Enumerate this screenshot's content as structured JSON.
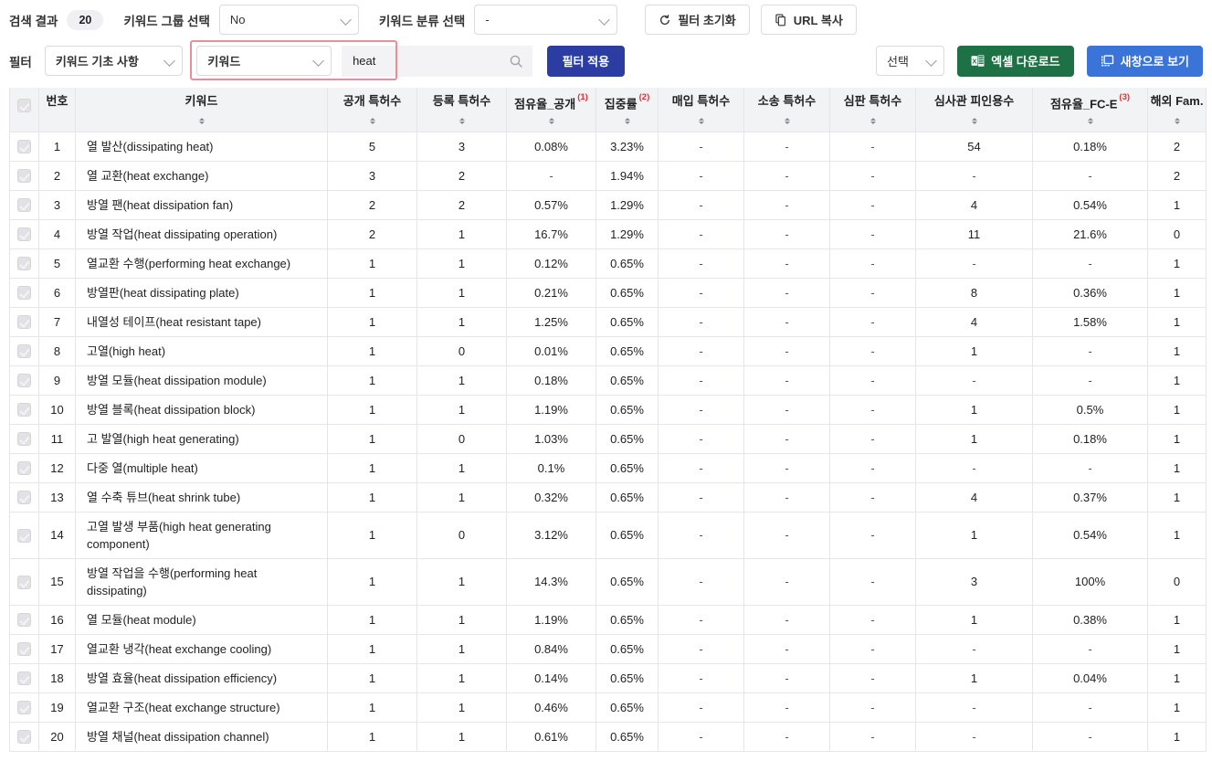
{
  "toolbar": {
    "result_label": "검색 결과",
    "result_count": "20",
    "group_label": "키워드 그룹 선택",
    "group_value": "No",
    "class_label": "키워드 분류 선택",
    "class_value": "-",
    "reset_button": "필터 초기화",
    "reset_icon": "refresh-icon",
    "copy_url_button": "URL 복사",
    "copy_url_icon": "copy-icon",
    "filter_label": "필터",
    "filter_field_value": "키워드 기초 사항",
    "filter_key_value": "키워드",
    "search_value": "heat",
    "search_placeholder": "",
    "search_icon": "search-icon",
    "apply_button": "필터 적용",
    "select_value": "선택",
    "excel_button": "엑셀 다운로드",
    "excel_icon": "excel-icon",
    "newwindow_button": "새창으로 보기",
    "newwindow_icon": "new-window-icon",
    "highlight_color": "#e98f99",
    "primary_color": "#2b3da3",
    "excel_color": "#1e7145",
    "newwindow_color": "#3b74d8",
    "superscript_color": "#e03131"
  },
  "table": {
    "columns": [
      {
        "key": "check",
        "label": "",
        "sup": "",
        "sortable": false
      },
      {
        "key": "no",
        "label": "번호",
        "sup": "",
        "sortable": false
      },
      {
        "key": "keyword",
        "label": "키워드",
        "sup": "",
        "sortable": true
      },
      {
        "key": "open_pat",
        "label": "공개 특허수",
        "sup": "",
        "sortable": true
      },
      {
        "key": "reg_pat",
        "label": "등록 특허수",
        "sup": "",
        "sortable": true
      },
      {
        "key": "share_open",
        "label": "점유율_공개",
        "sup": "(1)",
        "sortable": true
      },
      {
        "key": "conc",
        "label": "집중률",
        "sup": "(2)",
        "sortable": true
      },
      {
        "key": "buy_pat",
        "label": "매입 특허수",
        "sup": "",
        "sortable": true
      },
      {
        "key": "suit_pat",
        "label": "소송 특허수",
        "sup": "",
        "sortable": true
      },
      {
        "key": "trial_pat",
        "label": "심판 특허수",
        "sup": "",
        "sortable": true
      },
      {
        "key": "cited",
        "label": "심사관 피인용수",
        "sup": "",
        "sortable": true
      },
      {
        "key": "share_fce",
        "label": "점유율_FC-E",
        "sup": "(3)",
        "sortable": true
      },
      {
        "key": "overseas",
        "label": "해외 Fam.",
        "sup": "",
        "sortable": true
      }
    ],
    "rows": [
      {
        "no": "1",
        "keyword": "열 발산(dissipating heat)",
        "open_pat": "5",
        "reg_pat": "3",
        "share_open": "0.08%",
        "conc": "3.23%",
        "buy_pat": "-",
        "suit_pat": "-",
        "trial_pat": "-",
        "cited": "54",
        "share_fce": "0.18%",
        "overseas": "2",
        "checked": true
      },
      {
        "no": "2",
        "keyword": "열 교환(heat exchange)",
        "open_pat": "3",
        "reg_pat": "2",
        "share_open": "-",
        "conc": "1.94%",
        "buy_pat": "-",
        "suit_pat": "-",
        "trial_pat": "-",
        "cited": "-",
        "share_fce": "-",
        "overseas": "2",
        "checked": true
      },
      {
        "no": "3",
        "keyword": "방열 팬(heat dissipation fan)",
        "open_pat": "2",
        "reg_pat": "2",
        "share_open": "0.57%",
        "conc": "1.29%",
        "buy_pat": "-",
        "suit_pat": "-",
        "trial_pat": "-",
        "cited": "4",
        "share_fce": "0.54%",
        "overseas": "1",
        "checked": true
      },
      {
        "no": "4",
        "keyword": "방열 작업(heat dissipating operation)",
        "open_pat": "2",
        "reg_pat": "1",
        "share_open": "16.7%",
        "conc": "1.29%",
        "buy_pat": "-",
        "suit_pat": "-",
        "trial_pat": "-",
        "cited": "11",
        "share_fce": "21.6%",
        "overseas": "0",
        "checked": true
      },
      {
        "no": "5",
        "keyword": "열교환 수행(performing heat exchange)",
        "open_pat": "1",
        "reg_pat": "1",
        "share_open": "0.12%",
        "conc": "0.65%",
        "buy_pat": "-",
        "suit_pat": "-",
        "trial_pat": "-",
        "cited": "-",
        "share_fce": "-",
        "overseas": "1",
        "checked": true
      },
      {
        "no": "6",
        "keyword": "방열판(heat dissipating plate)",
        "open_pat": "1",
        "reg_pat": "1",
        "share_open": "0.21%",
        "conc": "0.65%",
        "buy_pat": "-",
        "suit_pat": "-",
        "trial_pat": "-",
        "cited": "8",
        "share_fce": "0.36%",
        "overseas": "1",
        "checked": true
      },
      {
        "no": "7",
        "keyword": "내열성 테이프(heat resistant tape)",
        "open_pat": "1",
        "reg_pat": "1",
        "share_open": "1.25%",
        "conc": "0.65%",
        "buy_pat": "-",
        "suit_pat": "-",
        "trial_pat": "-",
        "cited": "4",
        "share_fce": "1.58%",
        "overseas": "1",
        "checked": true
      },
      {
        "no": "8",
        "keyword": "고열(high heat)",
        "open_pat": "1",
        "reg_pat": "0",
        "share_open": "0.01%",
        "conc": "0.65%",
        "buy_pat": "-",
        "suit_pat": "-",
        "trial_pat": "-",
        "cited": "1",
        "share_fce": "-",
        "overseas": "1",
        "checked": true
      },
      {
        "no": "9",
        "keyword": "방열 모듈(heat dissipation module)",
        "open_pat": "1",
        "reg_pat": "1",
        "share_open": "0.18%",
        "conc": "0.65%",
        "buy_pat": "-",
        "suit_pat": "-",
        "trial_pat": "-",
        "cited": "-",
        "share_fce": "-",
        "overseas": "1",
        "checked": true
      },
      {
        "no": "10",
        "keyword": "방열 블록(heat dissipation block)",
        "open_pat": "1",
        "reg_pat": "1",
        "share_open": "1.19%",
        "conc": "0.65%",
        "buy_pat": "-",
        "suit_pat": "-",
        "trial_pat": "-",
        "cited": "1",
        "share_fce": "0.5%",
        "overseas": "1",
        "checked": true
      },
      {
        "no": "11",
        "keyword": "고 발열(high heat generating)",
        "open_pat": "1",
        "reg_pat": "0",
        "share_open": "1.03%",
        "conc": "0.65%",
        "buy_pat": "-",
        "suit_pat": "-",
        "trial_pat": "-",
        "cited": "1",
        "share_fce": "0.18%",
        "overseas": "1",
        "checked": true
      },
      {
        "no": "12",
        "keyword": "다중 열(multiple heat)",
        "open_pat": "1",
        "reg_pat": "1",
        "share_open": "0.1%",
        "conc": "0.65%",
        "buy_pat": "-",
        "suit_pat": "-",
        "trial_pat": "-",
        "cited": "-",
        "share_fce": "-",
        "overseas": "1",
        "checked": true
      },
      {
        "no": "13",
        "keyword": "열 수축 튜브(heat shrink tube)",
        "open_pat": "1",
        "reg_pat": "1",
        "share_open": "0.32%",
        "conc": "0.65%",
        "buy_pat": "-",
        "suit_pat": "-",
        "trial_pat": "-",
        "cited": "4",
        "share_fce": "0.37%",
        "overseas": "1",
        "checked": true
      },
      {
        "no": "14",
        "keyword": "고열 발생 부품(high heat generating component)",
        "open_pat": "1",
        "reg_pat": "0",
        "share_open": "3.12%",
        "conc": "0.65%",
        "buy_pat": "-",
        "suit_pat": "-",
        "trial_pat": "-",
        "cited": "1",
        "share_fce": "0.54%",
        "overseas": "1",
        "checked": true
      },
      {
        "no": "15",
        "keyword": "방열 작업을 수행(performing heat dissipating)",
        "open_pat": "1",
        "reg_pat": "1",
        "share_open": "14.3%",
        "conc": "0.65%",
        "buy_pat": "-",
        "suit_pat": "-",
        "trial_pat": "-",
        "cited": "3",
        "share_fce": "100%",
        "overseas": "0",
        "checked": true
      },
      {
        "no": "16",
        "keyword": "열 모듈(heat module)",
        "open_pat": "1",
        "reg_pat": "1",
        "share_open": "1.19%",
        "conc": "0.65%",
        "buy_pat": "-",
        "suit_pat": "-",
        "trial_pat": "-",
        "cited": "1",
        "share_fce": "0.38%",
        "overseas": "1",
        "checked": true
      },
      {
        "no": "17",
        "keyword": "열교환 냉각(heat exchange cooling)",
        "open_pat": "1",
        "reg_pat": "1",
        "share_open": "0.84%",
        "conc": "0.65%",
        "buy_pat": "-",
        "suit_pat": "-",
        "trial_pat": "-",
        "cited": "-",
        "share_fce": "-",
        "overseas": "1",
        "checked": true
      },
      {
        "no": "18",
        "keyword": "방열 효율(heat dissipation efficiency)",
        "open_pat": "1",
        "reg_pat": "1",
        "share_open": "0.14%",
        "conc": "0.65%",
        "buy_pat": "-",
        "suit_pat": "-",
        "trial_pat": "-",
        "cited": "1",
        "share_fce": "0.04%",
        "overseas": "1",
        "checked": true
      },
      {
        "no": "19",
        "keyword": "열교환 구조(heat exchange structure)",
        "open_pat": "1",
        "reg_pat": "1",
        "share_open": "0.46%",
        "conc": "0.65%",
        "buy_pat": "-",
        "suit_pat": "-",
        "trial_pat": "-",
        "cited": "-",
        "share_fce": "-",
        "overseas": "1",
        "checked": true
      },
      {
        "no": "20",
        "keyword": "방열 채널(heat dissipation channel)",
        "open_pat": "1",
        "reg_pat": "1",
        "share_open": "0.61%",
        "conc": "0.65%",
        "buy_pat": "-",
        "suit_pat": "-",
        "trial_pat": "-",
        "cited": "-",
        "share_fce": "-",
        "overseas": "1",
        "checked": true
      }
    ]
  }
}
